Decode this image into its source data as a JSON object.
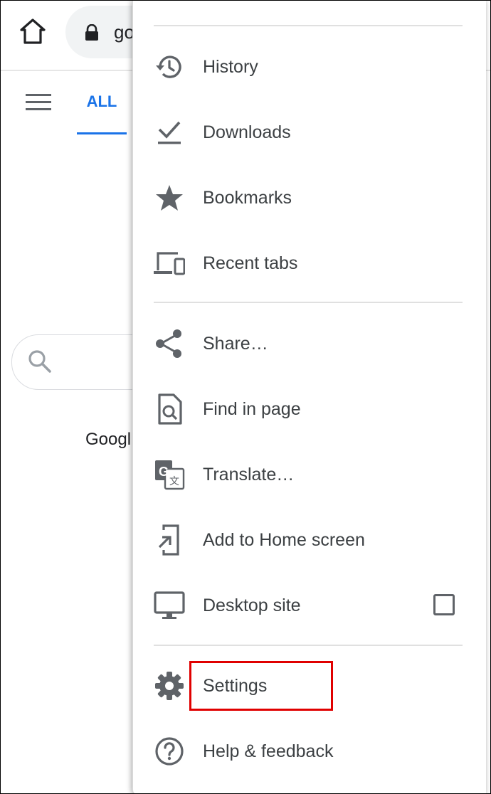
{
  "toolbar": {
    "url_partial": "go"
  },
  "tabs": {
    "active_label": "ALL"
  },
  "page": {
    "google_partial": "Googl"
  },
  "menu": {
    "items": [
      {
        "label": "History",
        "icon": "history-icon"
      },
      {
        "label": "Downloads",
        "icon": "download-icon"
      },
      {
        "label": "Bookmarks",
        "icon": "star-icon"
      },
      {
        "label": "Recent tabs",
        "icon": "devices-icon"
      },
      {
        "label": "Share…",
        "icon": "share-icon"
      },
      {
        "label": "Find in page",
        "icon": "find-in-page-icon"
      },
      {
        "label": "Translate…",
        "icon": "translate-icon"
      },
      {
        "label": "Add to Home screen",
        "icon": "add-to-home-icon"
      },
      {
        "label": "Desktop site",
        "icon": "desktop-icon",
        "checked": false
      },
      {
        "label": "Settings",
        "icon": "gear-icon",
        "highlighted": true
      },
      {
        "label": "Help & feedback",
        "icon": "help-icon"
      }
    ]
  },
  "colors": {
    "accent": "#1a73e8",
    "icon_gray": "#5f6368",
    "highlight_box": "#e00000"
  }
}
